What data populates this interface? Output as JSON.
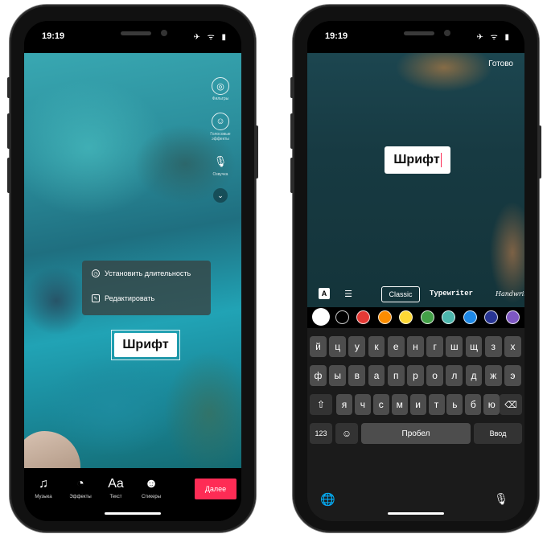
{
  "left_phone": {
    "status_time": "19:19",
    "status_icons": "✈ ᯤ ▮",
    "right_rail": [
      {
        "icon": "filter-icon",
        "glyph": "◎",
        "label": "Фильтры"
      },
      {
        "icon": "effects-icon",
        "glyph": "☺",
        "label": "Голосовые эффекты"
      },
      {
        "icon": "microphone-icon",
        "glyph": "🎙",
        "label": "Озвучка"
      }
    ],
    "rail_more_glyph": "⌄",
    "context_menu": {
      "set_duration_label": "Установить длительность",
      "edit_label": "Редактировать",
      "set_duration_icon": "clock-icon",
      "edit_icon": "pencil-icon"
    },
    "text_sticker": "Шрифт",
    "bottom_tools": [
      {
        "icon": "music-icon",
        "glyph": "♫",
        "label": "Музыка"
      },
      {
        "icon": "effects-timer-icon",
        "glyph": "◔",
        "label": "Эффекты"
      },
      {
        "icon": "text-icon",
        "glyph": "Aa",
        "label": "Текст"
      },
      {
        "icon": "sticker-icon",
        "glyph": "☻",
        "label": "Стикеры"
      }
    ],
    "next_button": "Далее",
    "colors": {
      "accent": "#fe2c55"
    }
  },
  "right_phone": {
    "status_time": "19:19",
    "status_icons": "✈ ᯤ ▮",
    "done_button": "Готово",
    "editing_text": "Шрифт",
    "font_toolbar": {
      "style_button": "A",
      "align_icon": "☰",
      "fonts": [
        "Classic",
        "Typewriter",
        "Handwriting"
      ],
      "selected_font": "Classic"
    },
    "swatches": [
      "#ffffff",
      "#000000",
      "#e53935",
      "#fb8c00",
      "#fdd835",
      "#43a047",
      "#4db6ac",
      "#1e88e5",
      "#283593",
      "#7e57c2"
    ],
    "keyboard": {
      "row1": [
        "й",
        "ц",
        "у",
        "к",
        "е",
        "н",
        "г",
        "ш",
        "щ",
        "з",
        "х"
      ],
      "row2": [
        "ф",
        "ы",
        "в",
        "а",
        "п",
        "р",
        "о",
        "л",
        "д",
        "ж",
        "э"
      ],
      "row3": [
        "я",
        "ч",
        "с",
        "м",
        "и",
        "т",
        "ь",
        "б",
        "ю"
      ],
      "shift_glyph": "⇧",
      "backspace_glyph": "⌫",
      "num_label": "123",
      "emoji_glyph": "☺",
      "space_label": "Пробел",
      "enter_label": "Ввод",
      "globe_glyph": "🌐",
      "mic_glyph": "🎙"
    }
  }
}
